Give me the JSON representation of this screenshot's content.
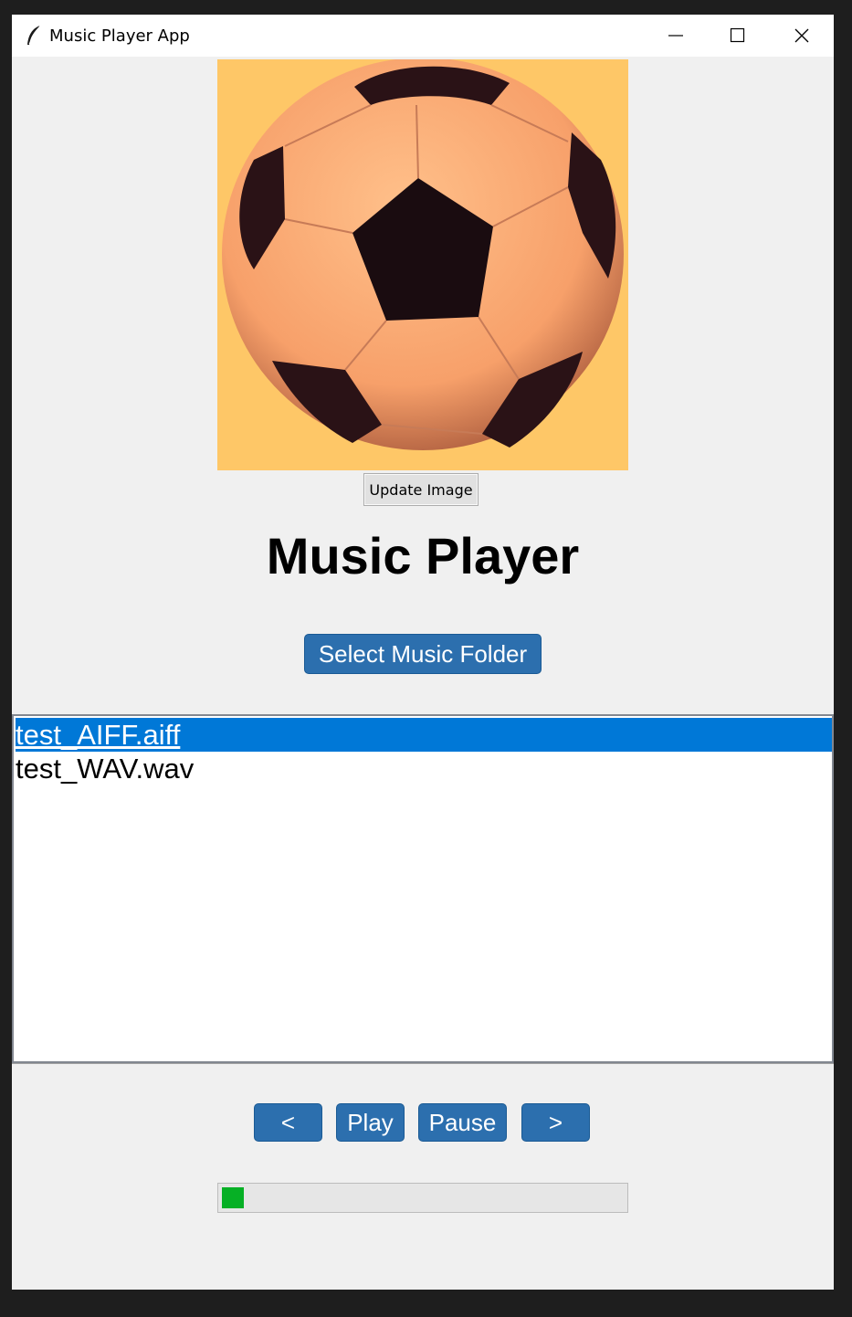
{
  "window": {
    "title": "Music Player App",
    "icon": "feather-icon",
    "controls": {
      "minimize": "minimize-icon",
      "maximize": "maximize-icon",
      "close": "close-icon"
    }
  },
  "image": {
    "alt_icon": "soccer-ball-image",
    "background": "#fec767"
  },
  "update_button": {
    "label": "Update Image"
  },
  "heading": {
    "text": "Music Player"
  },
  "folder_button": {
    "label": "Select Music Folder"
  },
  "playlist": {
    "items": [
      {
        "label": "test_AIFF.aiff",
        "selected": true
      },
      {
        "label": "test_WAV.wav",
        "selected": false
      }
    ]
  },
  "controls": {
    "prev_label": "<",
    "play_label": "Play",
    "pause_label": "Pause",
    "next_label": ">"
  },
  "progress": {
    "fraction": 0.055,
    "color": "#06b025"
  },
  "colors": {
    "accent": "#2c6fae",
    "selection": "#0078d7"
  }
}
